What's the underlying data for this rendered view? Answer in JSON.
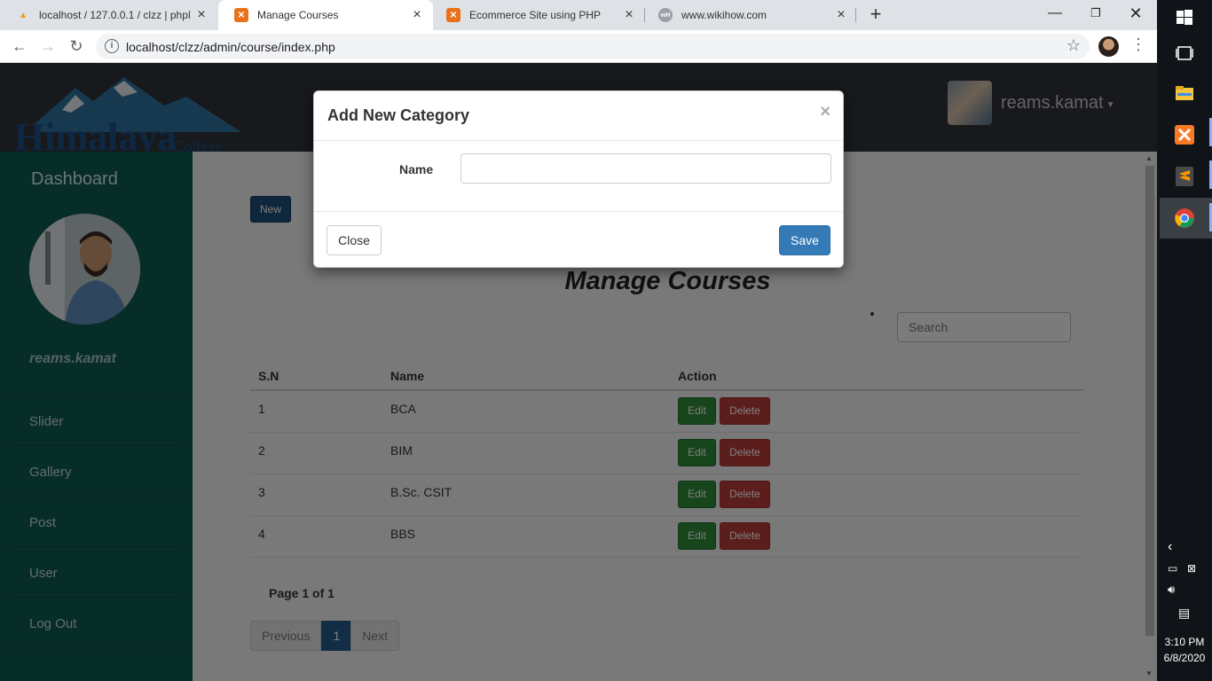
{
  "browser": {
    "tabs": [
      {
        "label": "localhost / 127.0.0.1 / clzz | phpM",
        "active": false,
        "icon": "phpmyadmin-icon"
      },
      {
        "label": "Manage Courses",
        "active": true,
        "icon": "xampp-icon"
      },
      {
        "label": "Ecommerce Site using PHP",
        "active": false,
        "icon": "xampp-icon"
      },
      {
        "label": "www.wikihow.com",
        "active": false,
        "icon": "globe-icon"
      }
    ],
    "url": "localhost/clzz/admin/course/index.php"
  },
  "header": {
    "logo_text": "Himalaya",
    "logo_sub": "College",
    "username": "reams.kamat"
  },
  "sidebar": {
    "title": "Dashboard",
    "user": "reams.kamat",
    "items": [
      {
        "label": "Slider"
      },
      {
        "label": "Gallery"
      },
      {
        "label": "Post"
      },
      {
        "label": "User"
      },
      {
        "label": "Log Out"
      }
    ]
  },
  "main": {
    "new_label": "New",
    "title": "Manage Courses",
    "search_placeholder": "Search",
    "columns": [
      "S.N",
      "Name",
      "Action"
    ],
    "rows": [
      {
        "sn": "1",
        "name": "BCA"
      },
      {
        "sn": "2",
        "name": "BIM"
      },
      {
        "sn": "3",
        "name": "B.Sc. CSIT"
      },
      {
        "sn": "4",
        "name": "BBS"
      }
    ],
    "edit_label": "Edit",
    "delete_label": "Delete",
    "page_info": "Page 1 of 1",
    "pager": {
      "prev": "Previous",
      "current": "1",
      "next": "Next"
    }
  },
  "modal": {
    "title": "Add New Category",
    "close_x": "×",
    "name_label": "Name",
    "name_value": "",
    "close_label": "Close",
    "save_label": "Save"
  },
  "taskbar": {
    "time": "3:10 PM",
    "date": "6/8/2020"
  },
  "colors": {
    "sidebar": "#0e5a52",
    "header": "#2e3338",
    "primary": "#337ab7",
    "success": "#2e8a39",
    "danger": "#b83c3a"
  }
}
